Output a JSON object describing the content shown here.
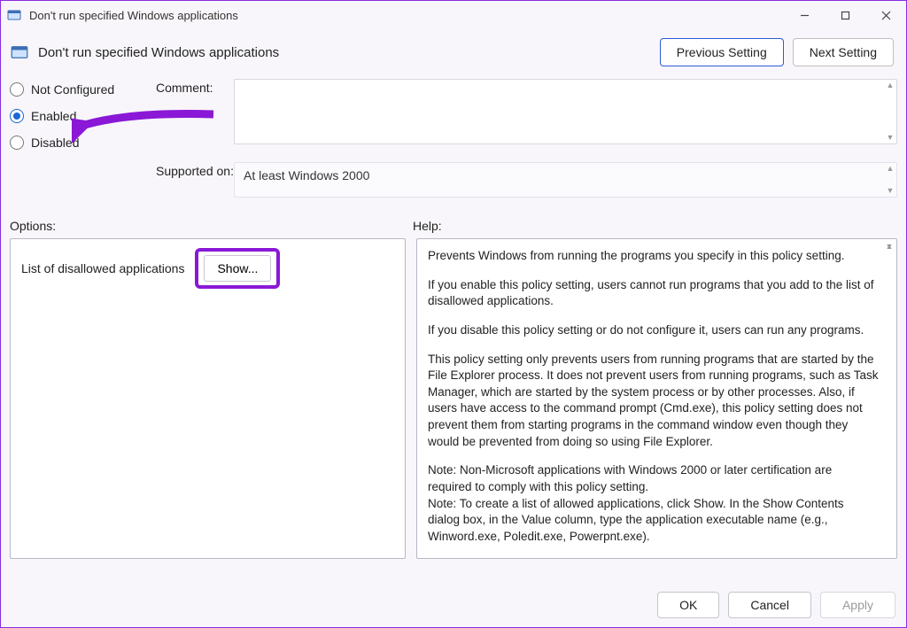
{
  "window": {
    "title": "Don't run specified Windows applications"
  },
  "header": {
    "setting_title": "Don't run specified Windows applications",
    "prev": "Previous Setting",
    "next": "Next Setting"
  },
  "radios": {
    "not_configured": "Not Configured",
    "enabled": "Enabled",
    "disabled": "Disabled",
    "selected": "enabled"
  },
  "meta": {
    "comment_label": "Comment:",
    "comment_value": "",
    "supported_label": "Supported on:",
    "supported_value": "At least Windows 2000"
  },
  "pane_labels": {
    "options": "Options:",
    "help": "Help:"
  },
  "options": {
    "list_label": "List of disallowed applications",
    "show_button": "Show..."
  },
  "help": {
    "p1": "Prevents Windows from running the programs you specify in this policy setting.",
    "p2": "If you enable this policy setting, users cannot run programs that you add to the list of disallowed applications.",
    "p3": "If you disable this policy setting or do not configure it, users can run any programs.",
    "p4": "This policy setting only prevents users from running programs that are started by the File Explorer process. It does not prevent users from running programs, such as Task Manager, which are started by the system process or by other processes.  Also, if users have access to the command prompt (Cmd.exe), this policy setting does not prevent them from starting programs in the command window even though they would be prevented from doing so using File Explorer.",
    "p5": "Note: Non-Microsoft applications with Windows 2000 or later certification are required to comply with this policy setting.",
    "p6": "Note: To create a list of allowed applications, click Show.  In the Show Contents dialog box, in the Value column, type the application executable name (e.g., Winword.exe, Poledit.exe, Powerpnt.exe)."
  },
  "footer": {
    "ok": "OK",
    "cancel": "Cancel",
    "apply": "Apply"
  }
}
